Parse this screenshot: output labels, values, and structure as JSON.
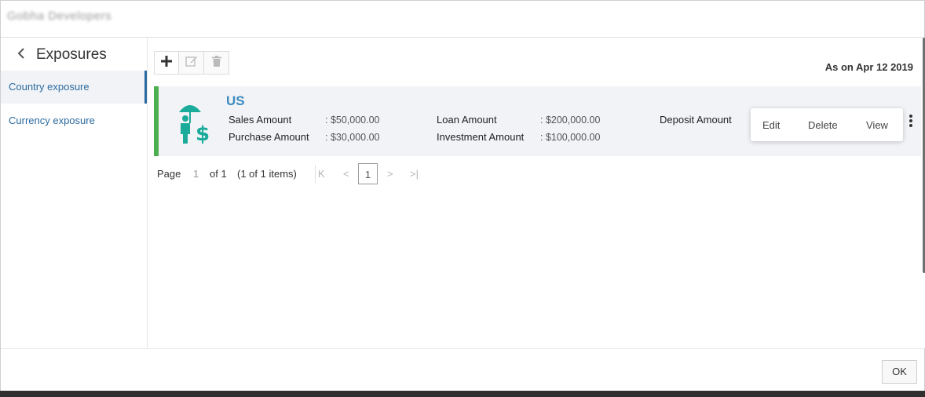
{
  "window": {
    "title": "Gobha Developers"
  },
  "sidebar": {
    "title": "Exposures",
    "items": [
      {
        "label": "Country exposure",
        "active": true
      },
      {
        "label": "Currency exposure",
        "active": false
      }
    ]
  },
  "toolbar": {
    "buttons": [
      {
        "icon": "plus-icon"
      },
      {
        "icon": "edit-icon"
      },
      {
        "icon": "trash-icon"
      }
    ]
  },
  "header": {
    "as_on": "As on Apr 12 2019"
  },
  "card": {
    "title": "US",
    "icon": "umbrella-person-dollar-icon",
    "fields": {
      "sales_label": "Sales Amount",
      "sales_value": ": $50,000.00",
      "purchase_label": "Purchase Amount",
      "purchase_value": ": $30,000.00",
      "loan_label": "Loan Amount",
      "loan_value": ": $200,000.00",
      "investment_label": "Investment Amount",
      "investment_value": ": $100,000.00",
      "deposit_label": "Deposit Amount"
    },
    "menu": {
      "edit": "Edit",
      "delete": "Delete",
      "view": "View"
    }
  },
  "pager": {
    "page_label": "Page",
    "page_number": "1",
    "of_label": "of 1",
    "items_label": "(1 of 1 items)",
    "current": "1",
    "first": "K",
    "prev": "<",
    "next": ">",
    "last": ">|"
  },
  "footer": {
    "ok": "OK"
  },
  "colors": {
    "accent": "#2b6aa0",
    "title_blue": "#3a8bc0",
    "status_green": "#4caf50",
    "icon_teal": "#1aab9b"
  }
}
